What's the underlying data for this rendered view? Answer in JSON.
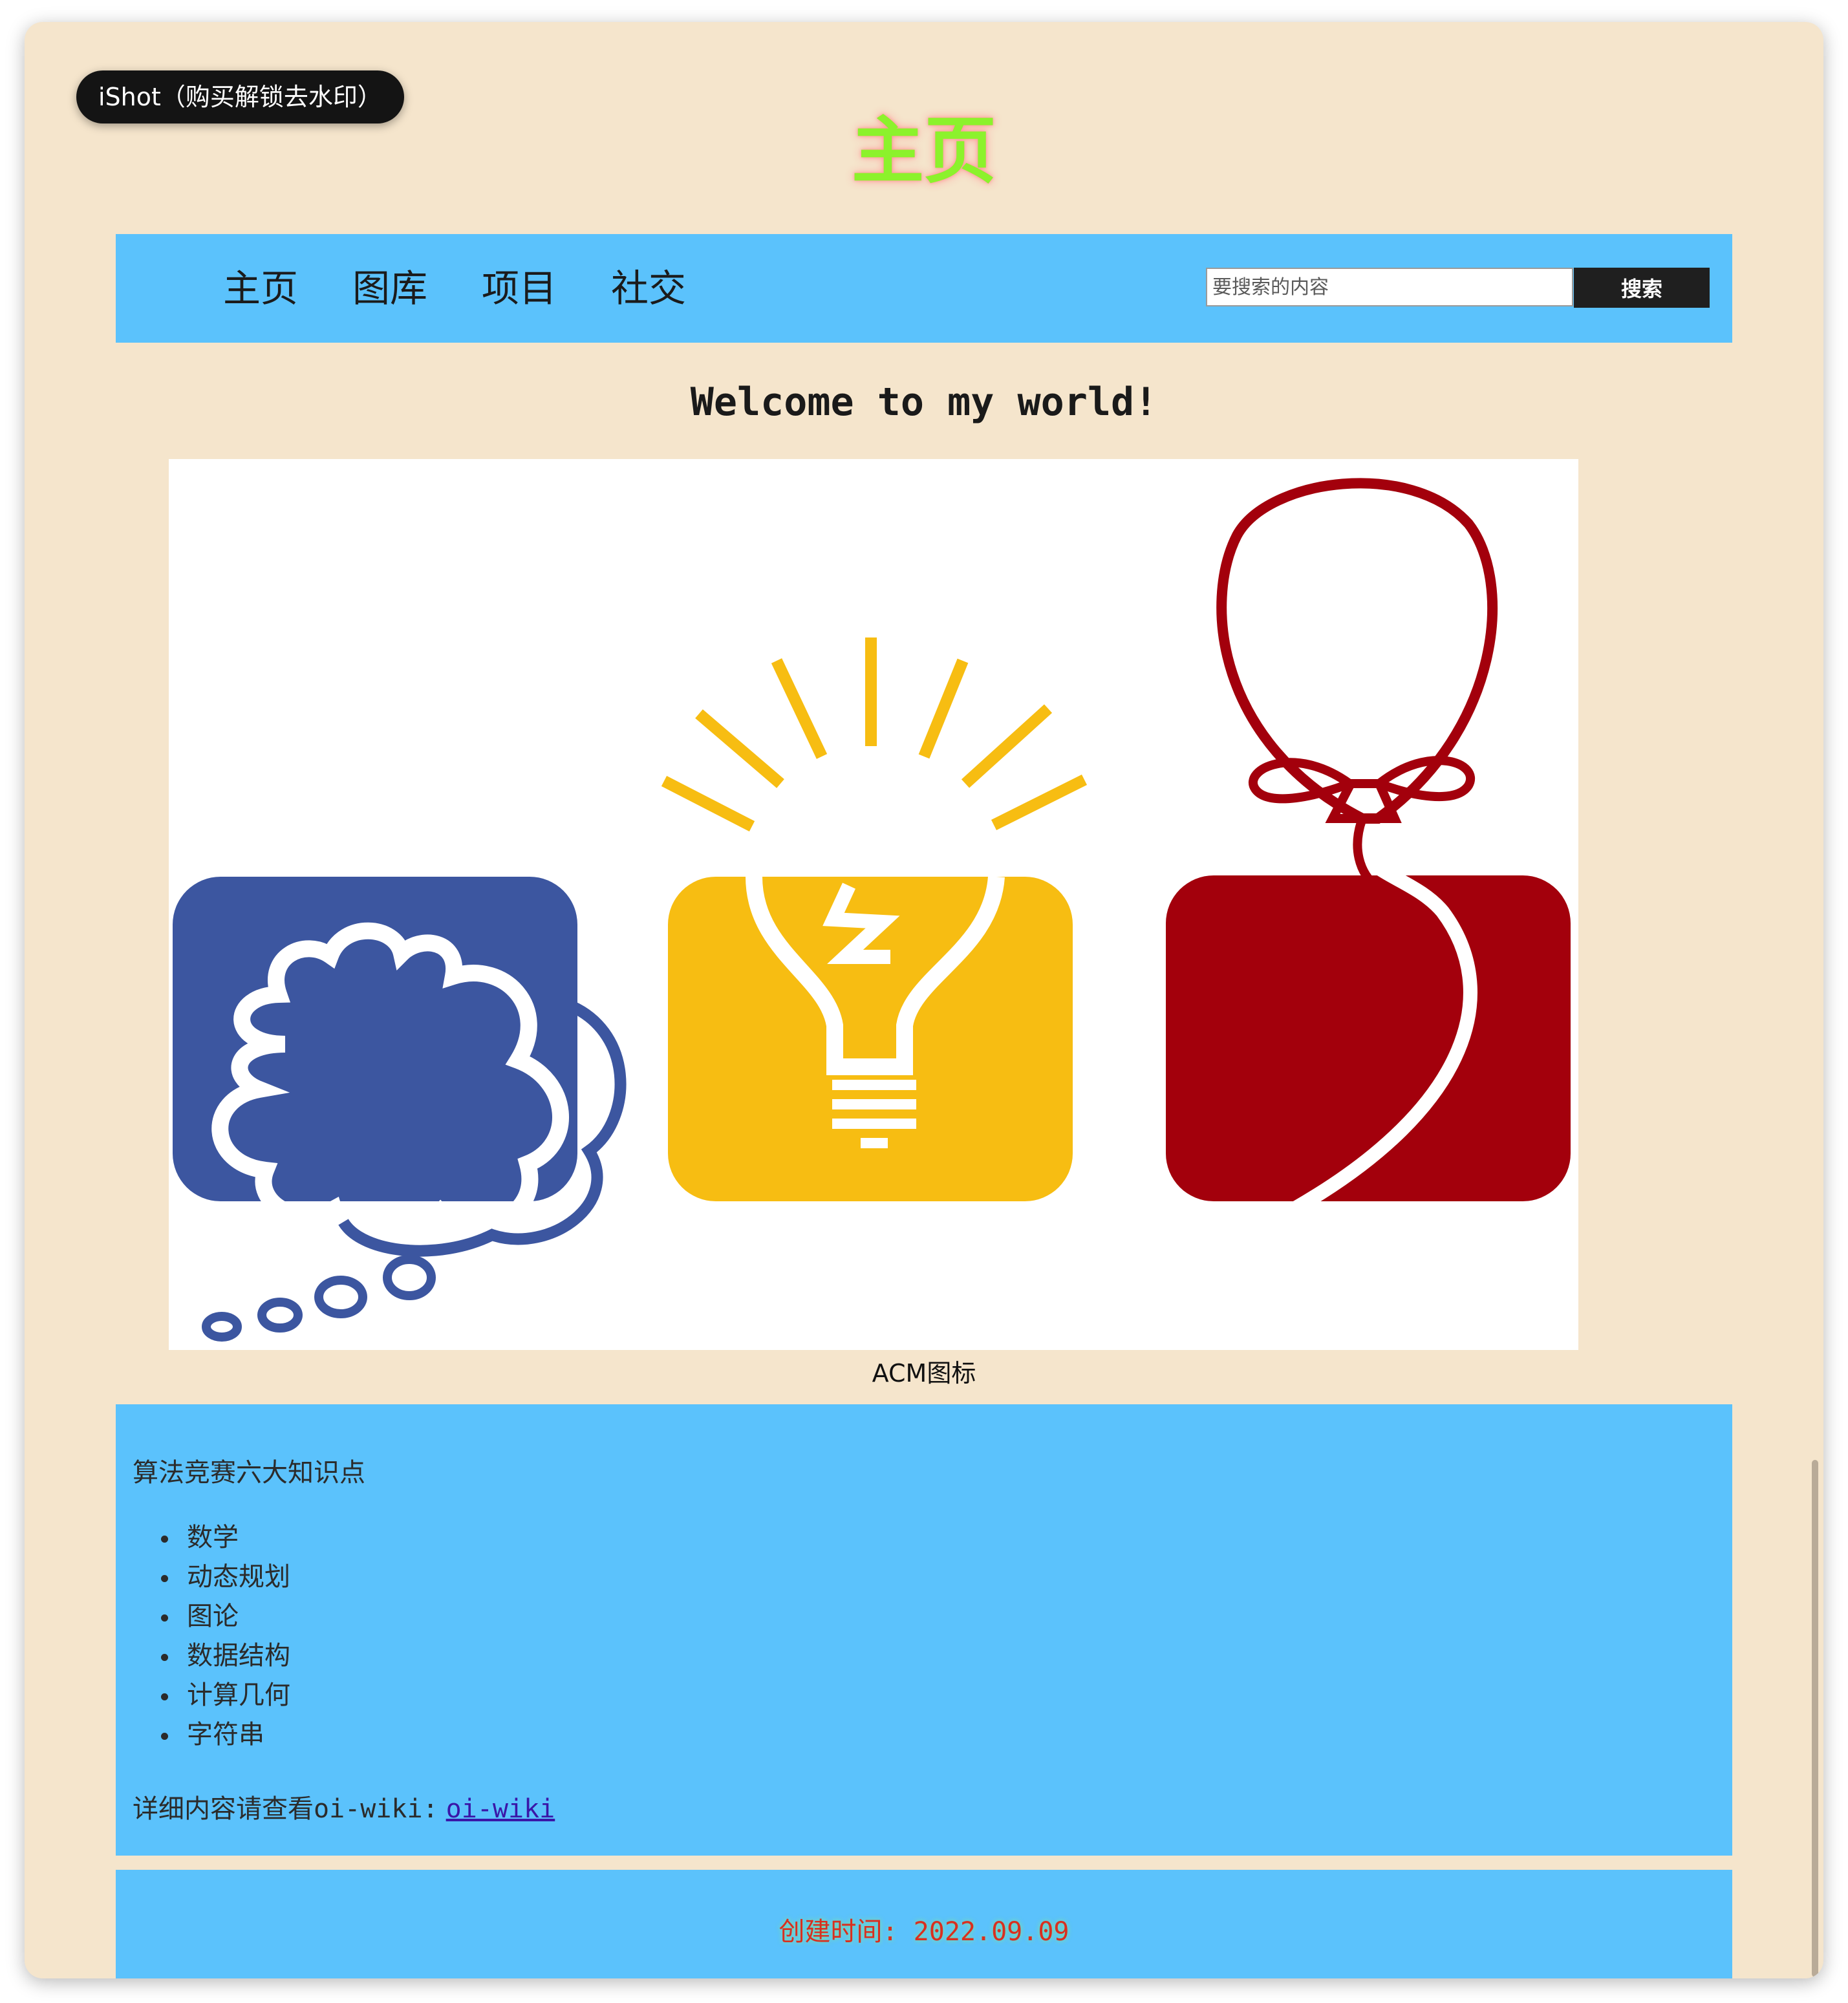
{
  "watermark": {
    "text": "iShot（购买解锁去水印）"
  },
  "page": {
    "title": "主页"
  },
  "nav": {
    "items": [
      {
        "label": "主页"
      },
      {
        "label": "图库"
      },
      {
        "label": "项目"
      },
      {
        "label": "社交"
      }
    ],
    "search": {
      "placeholder": "要搜索的内容",
      "value": ""
    },
    "search_button": "搜索"
  },
  "main": {
    "welcome": "Welcome to my world!",
    "image_caption": "ACM图标",
    "image_colors": {
      "blue": "#3c56a0",
      "yellow": "#f7bd12",
      "red": "#a3000c"
    }
  },
  "content": {
    "heading": "算法竞赛六大知识点",
    "topics": [
      "数学",
      "动态规划",
      "图论",
      "数据结构",
      "计算几何",
      "字符串"
    ],
    "more_prefix": "详细内容请查看oi-wiki:",
    "more_link": "oi-wiki"
  },
  "footer": {
    "created": "创建时间: 2022.09.09"
  },
  "colors": {
    "page_background": "#f5e5cc",
    "panel_background": "#5bc2fc",
    "title_color": "#8cf22c",
    "footer_text": "#d92f1f"
  }
}
